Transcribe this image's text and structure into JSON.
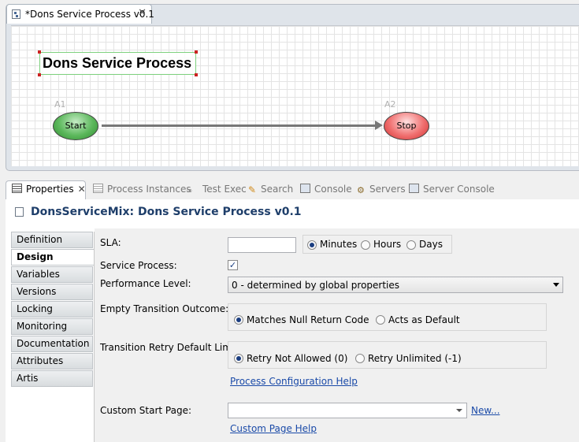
{
  "editor": {
    "tab_label": "*Dons Service Process v0.1",
    "process_title": "Dons Service Process",
    "nodes": [
      {
        "id": "A1",
        "label": "Start"
      },
      {
        "id": "A2",
        "label": "Stop"
      }
    ]
  },
  "properties": {
    "tabs": [
      {
        "label": "Properties",
        "active": true
      },
      {
        "label": "Process Instances"
      },
      {
        "label": "Test Exec"
      },
      {
        "label": "Search"
      },
      {
        "label": "Console"
      },
      {
        "label": "Servers"
      },
      {
        "label": "Server Console"
      }
    ],
    "title": "DonsServiceMix: Dons Service Process v0.1",
    "categories": [
      "Definition",
      "Design",
      "Variables",
      "Versions",
      "Locking",
      "Monitoring",
      "Documentation",
      "Attributes",
      "Artis"
    ],
    "selected_category": "Design",
    "form": {
      "sla_label": "SLA:",
      "sla_value": "",
      "sla_units": [
        "Minutes",
        "Hours",
        "Days"
      ],
      "sla_unit_selected": "Minutes",
      "service_process_label": "Service Process:",
      "service_process_checked": true,
      "performance_label": "Performance Level:",
      "performance_value": "0 - determined by global properties",
      "empty_transition_label": "Empty Transition Outcome:",
      "empty_transition_options": [
        "Matches Null Return Code",
        "Acts as Default"
      ],
      "empty_transition_selected": "Matches Null Return Code",
      "retry_label": "Transition Retry Default Limit:",
      "retry_options": [
        "Retry Not Allowed (0)",
        "Retry Unlimited (-1)"
      ],
      "retry_selected": "Retry Not Allowed (0)",
      "config_help_link": "Process Configuration Help",
      "custom_start_label": "Custom Start Page:",
      "custom_start_value": "",
      "new_link": "New...",
      "custom_help_link": "Custom Page Help"
    }
  }
}
